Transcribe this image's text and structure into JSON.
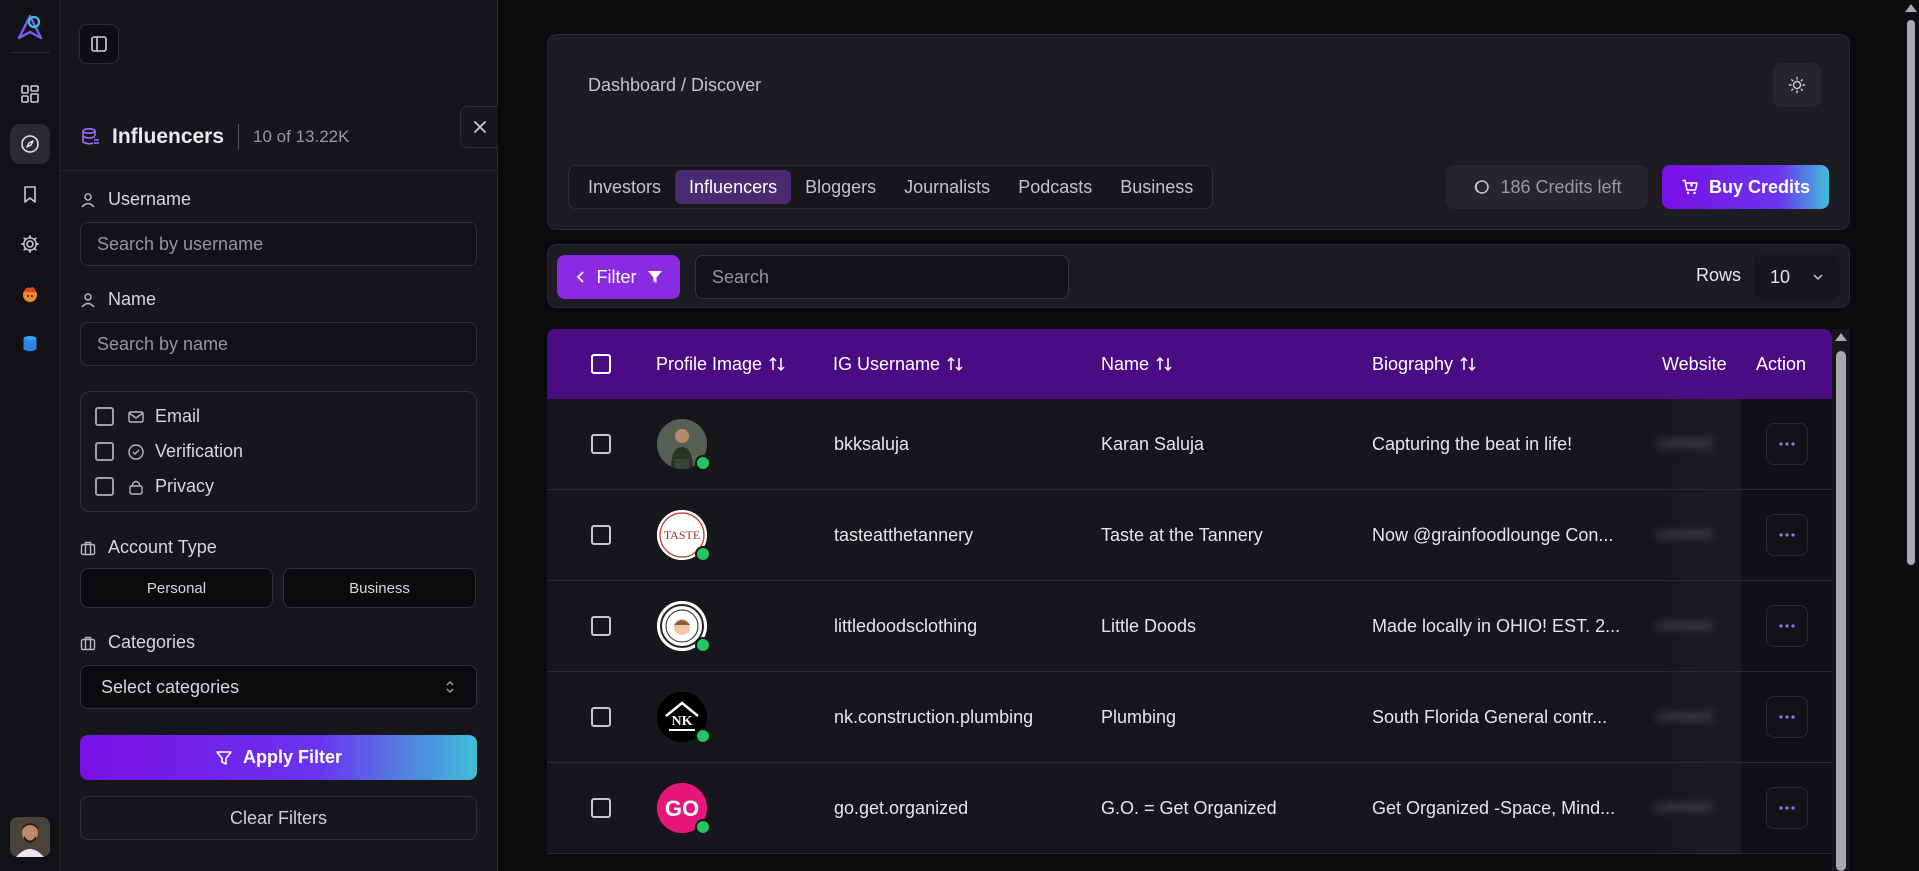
{
  "rail": {
    "items": [
      "dashboard",
      "discover",
      "saved",
      "settings",
      "fire",
      "database"
    ]
  },
  "panel": {
    "title": "Influencers",
    "count": "10 of 13.22K",
    "username_label": "Username",
    "username_placeholder": "Search by username",
    "name_label": "Name",
    "name_placeholder": "Search by name",
    "checks": [
      {
        "label": "Email",
        "icon": "mail-icon"
      },
      {
        "label": "Verification",
        "icon": "badge-check-icon"
      },
      {
        "label": "Privacy",
        "icon": "lock-icon"
      }
    ],
    "account_type_label": "Account Type",
    "account_types": [
      "Personal",
      "Business"
    ],
    "categories_label": "Categories",
    "categories_placeholder": "Select categories",
    "apply_label": "Apply Filter",
    "clear_label": "Clear Filters"
  },
  "header": {
    "breadcrumb": "Dashboard / Discover",
    "tabs": [
      "Investors",
      "Influencers",
      "Bloggers",
      "Journalists",
      "Podcasts",
      "Business"
    ],
    "active_tab": "Influencers",
    "credits": "186 Credits left",
    "buy_label": "Buy Credits"
  },
  "toolbar": {
    "filter_label": "Filter",
    "search_placeholder": "Search",
    "rows_label": "Rows",
    "rows_value": "10"
  },
  "table": {
    "columns": [
      "Profile Image",
      "IG Username",
      "Name",
      "Biography",
      "Website",
      "Action"
    ],
    "rows": [
      {
        "username": "bkksaluja",
        "name": "Karan Saluja",
        "bio": "Capturing the beat in life!",
        "website": "connect",
        "avatar_bg": "#3b4a3a",
        "avatar_text": ""
      },
      {
        "username": "tasteatthetannery",
        "name": "Taste at the Tannery",
        "bio": "Now @grainfoodlounge Con...",
        "website": "connect",
        "avatar_bg": "#ffffff",
        "avatar_text": "TASTE"
      },
      {
        "username": "littledoodsclothing",
        "name": "Little Doods",
        "bio": "Made locally in OHIO! EST. 2...",
        "website": "connect",
        "avatar_bg": "#ffffff",
        "avatar_text": ""
      },
      {
        "username": "nk.construction.plumbing",
        "name": "Plumbing",
        "bio": "South Florida General contr...",
        "website": "connect",
        "avatar_bg": "#000000",
        "avatar_text": "NK"
      },
      {
        "username": "go.get.organized",
        "name": "G.O. = Get Organized",
        "bio": "Get Organized -Space, Mind...",
        "website": "connect",
        "avatar_bg": "#e6177a",
        "avatar_text": "GO"
      }
    ]
  },
  "colors": {
    "accent": "#8a2be2",
    "header_bg": "#4b0b82",
    "status_online": "#22c55e"
  }
}
